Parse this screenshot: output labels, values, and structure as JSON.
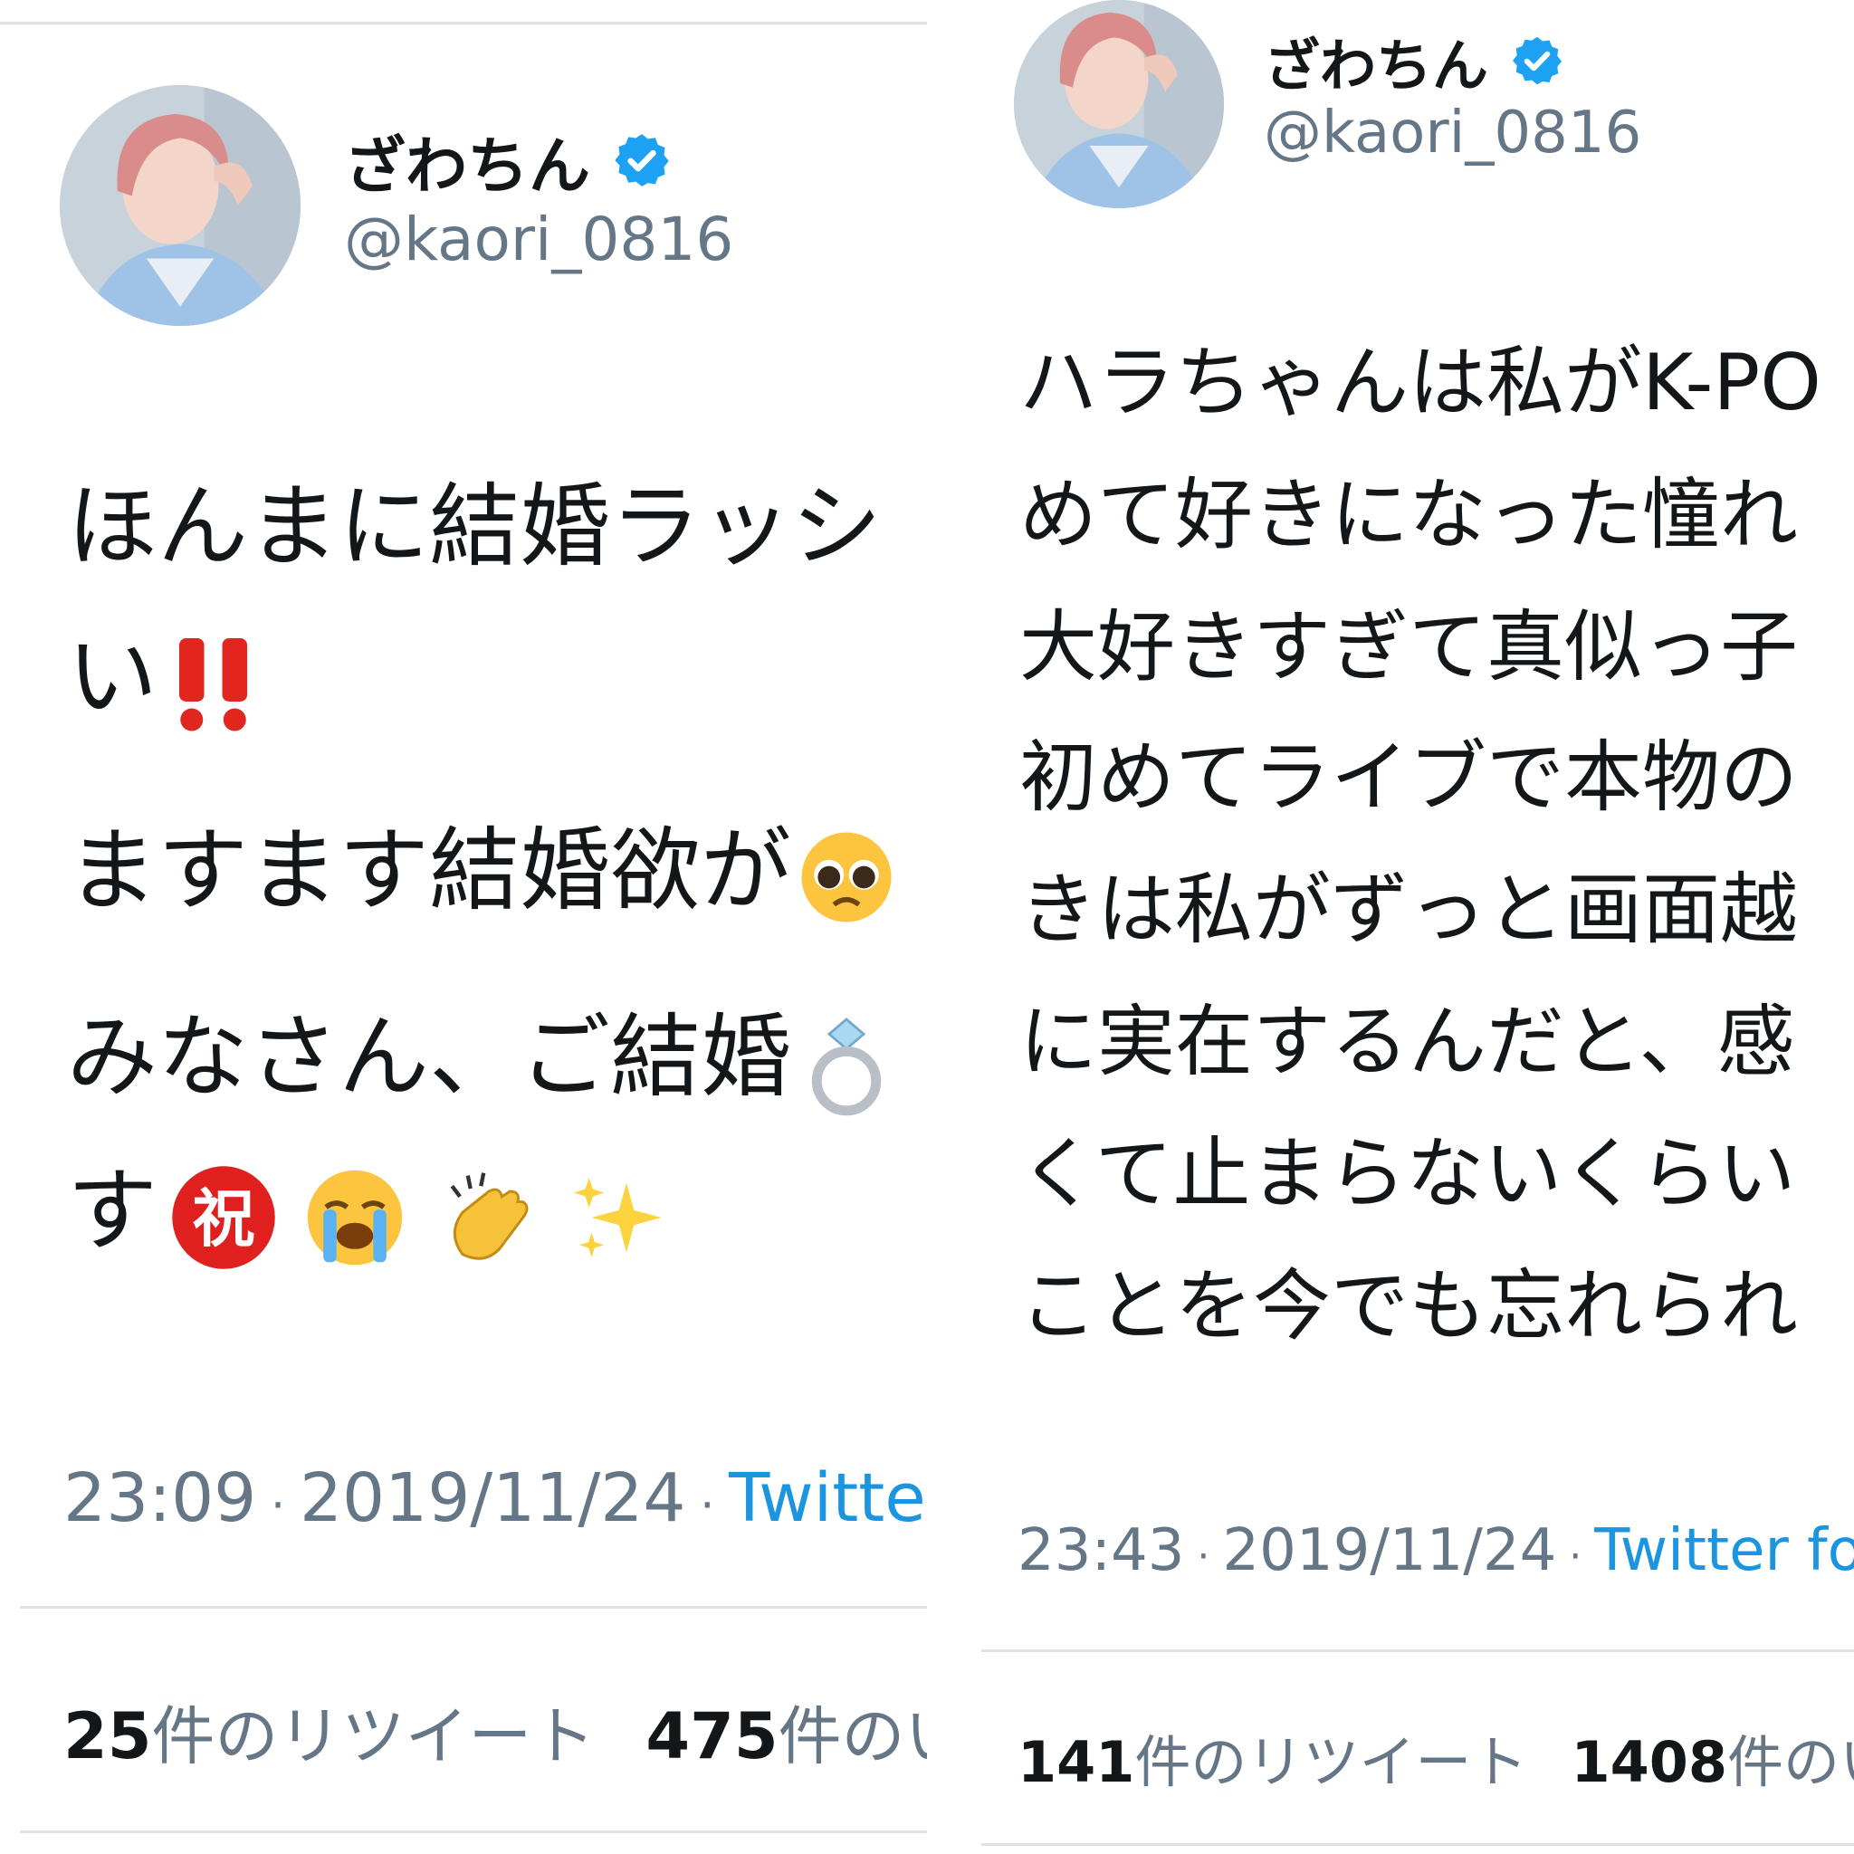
{
  "colors": {
    "text": "#14171a",
    "muted": "#657786",
    "link": "#1b95e0",
    "verified": "#1da1f2",
    "divider": "#dfe3e7"
  },
  "tweets": [
    {
      "display_name": "ざわちん",
      "verified_icon": "verified-badge-icon",
      "handle": "@kaori_0816",
      "lines": [
        {
          "text": "ほんまに結婚ラッシ"
        },
        {
          "text": "い",
          "emoji": [
            "double-exclamation-icon"
          ]
        },
        {
          "text": "ますます結婚欲が",
          "emoji": [
            "pleading-face-icon"
          ]
        },
        {
          "text": "みなさん、ご結婚",
          "emoji": [
            "ring-icon"
          ]
        },
        {
          "text": "す",
          "emoji": [
            "congratulations-kanji-icon",
            "loudly-crying-face-icon",
            "clapping-hands-icon",
            "sparkles-icon"
          ]
        }
      ],
      "time": "23:09",
      "date": "2019/11/24",
      "source": "Twitter",
      "retweet_count": "25",
      "retweet_label": "件のリツイート",
      "like_count": "475",
      "like_label": "件のい"
    },
    {
      "display_name": "ざわちん",
      "verified_icon": "verified-badge-icon",
      "handle": "@kaori_0816",
      "lines": [
        {
          "text": "ハラちゃんは私がK-PO"
        },
        {
          "text": "めて好きになった憧れ"
        },
        {
          "text": "大好きすぎて真似っ子"
        },
        {
          "text": "初めてライブで本物の"
        },
        {
          "text": "きは私がずっと画面越"
        },
        {
          "text": "に実在するんだと、感"
        },
        {
          "text": "くて止まらないくらい"
        },
        {
          "text": "ことを今でも忘れられ"
        }
      ],
      "time": "23:43",
      "date": "2019/11/24",
      "source": "Twitter fo",
      "retweet_count": "141",
      "retweet_label": "件のリツイート",
      "like_count": "1408",
      "like_label": "件のい"
    }
  ]
}
